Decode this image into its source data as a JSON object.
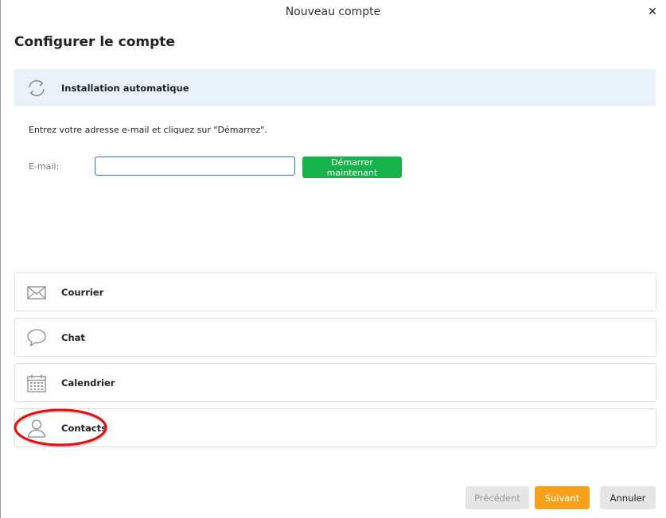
{
  "window": {
    "title": "Nouveau compte",
    "close_glyph": "✕"
  },
  "page": {
    "heading": "Configurer le compte"
  },
  "auto_setup": {
    "icon": "sync-icon",
    "label": "Installation automatique",
    "background": "#e9f1fb"
  },
  "form": {
    "instruction": "Entrez votre adresse e-mail et cliquez sur \"Démarrez\".",
    "email_label": "E-mail:",
    "email_value": "",
    "start_button": "Démarrer maintenant",
    "start_button_color": "#16b24a"
  },
  "account_types": [
    {
      "icon": "mail-icon",
      "label": "Courrier"
    },
    {
      "icon": "chat-icon",
      "label": "Chat"
    },
    {
      "icon": "calendar-icon",
      "label": "Calendrier"
    },
    {
      "icon": "contact-icon",
      "label": "Contacts"
    }
  ],
  "footer": {
    "prev": "Précédent",
    "next": "Suivant",
    "cancel": "Annuler",
    "next_color": "#f7a11a"
  }
}
